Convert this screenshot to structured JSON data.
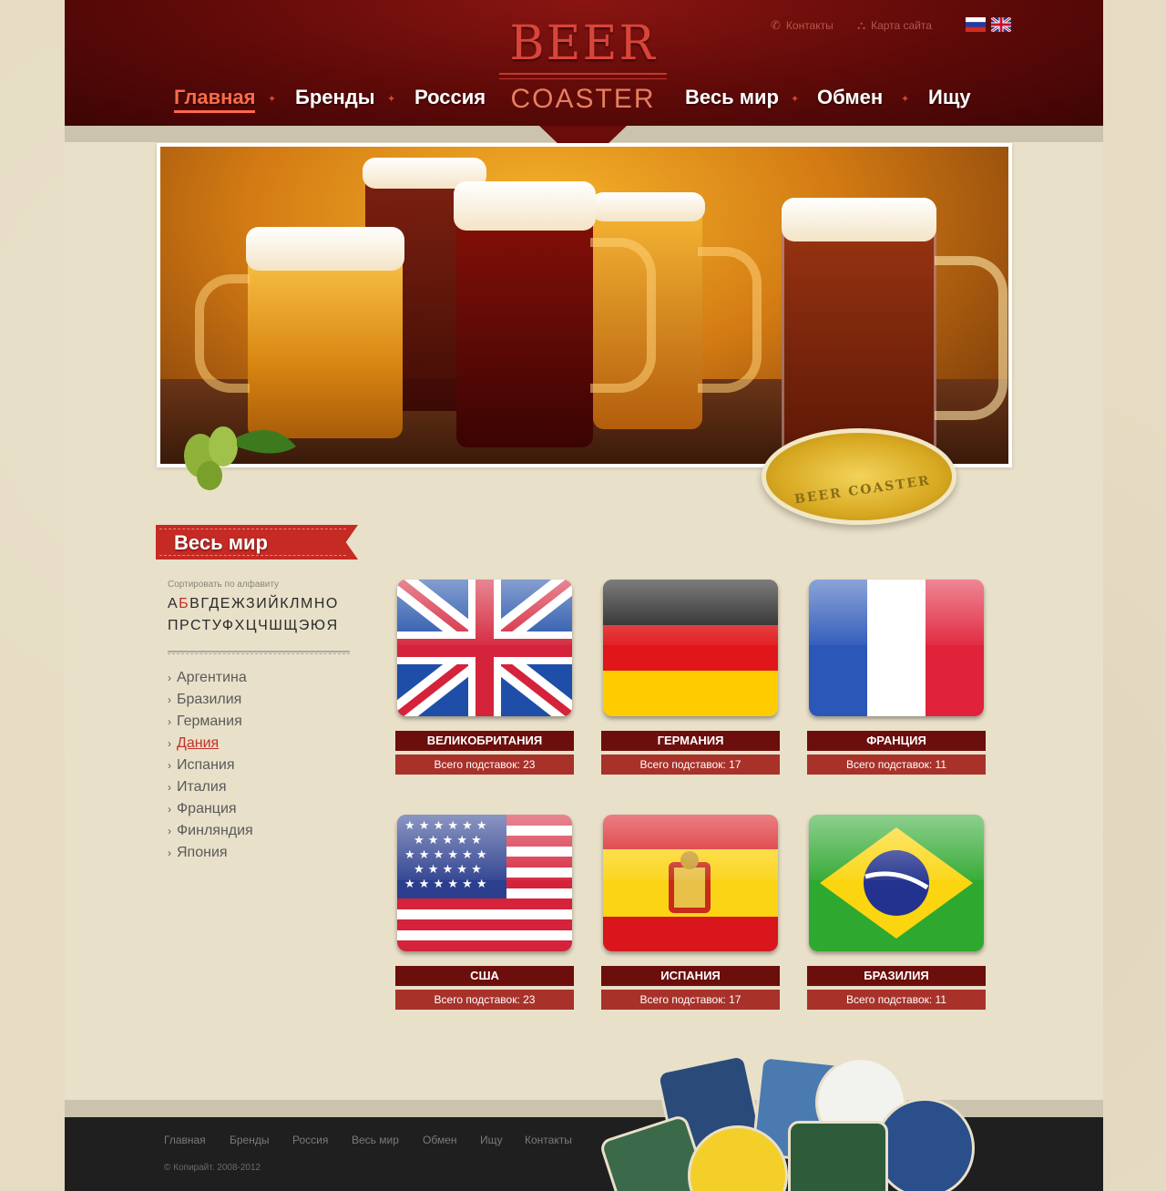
{
  "header": {
    "logo_top": "BEER",
    "logo_bottom": "COASTER",
    "nav": [
      "Главная",
      "Бренды",
      "Россия",
      "Весь мир",
      "Обмен",
      "Ищу"
    ],
    "active_nav": "Главная",
    "top_links": {
      "contacts": "Контакты",
      "sitemap": "Карта сайта"
    },
    "languages": [
      "ru",
      "en"
    ]
  },
  "hero": {
    "badge_text": "BEER COASTER"
  },
  "section": {
    "title": "Весь мир"
  },
  "sidebar": {
    "sort_label": "Сортировать по алфавиту",
    "alphabet_row1": {
      "a": "А",
      "hl": "Б",
      "rest": "ВГДЕЖЗИЙКЛМНО"
    },
    "alphabet_row2": "ПРСТУФХЦЧШЩЭЮЯ",
    "countries": [
      {
        "label": "Аргентина",
        "active": false
      },
      {
        "label": "Бразилия",
        "active": false
      },
      {
        "label": "Германия",
        "active": false
      },
      {
        "label": "Дания",
        "active": true
      },
      {
        "label": "Испания",
        "active": false
      },
      {
        "label": "Италия",
        "active": false
      },
      {
        "label": "Франция",
        "active": false
      },
      {
        "label": "Финляндия",
        "active": false
      },
      {
        "label": "Япония",
        "active": false
      }
    ]
  },
  "flags": [
    {
      "name": "ВЕЛИКОБРИТАНИЯ",
      "count": "Всего подставок: 23",
      "flag": "uk-flag"
    },
    {
      "name": "ГЕРМАНИЯ",
      "count": "Всего подставок: 17",
      "flag": "germany-flag"
    },
    {
      "name": "ФРАНЦИЯ",
      "count": "Всего подставок: 11",
      "flag": "france-flag"
    },
    {
      "name": "США",
      "count": "Всего подставок: 23",
      "flag": "usa-flag"
    },
    {
      "name": "ИСПАНИЯ",
      "count": "Всего подставок: 17",
      "flag": "spain-flag"
    },
    {
      "name": "БРАЗИЛИЯ",
      "count": "Всего подставок: 11",
      "flag": "brazil-flag"
    }
  ],
  "footer": {
    "links": [
      "Главная",
      "Бренды",
      "Россия",
      "Весь мир",
      "Обмен",
      "Ищу",
      "Контакты"
    ],
    "copyright": "© Копирайт. 2008-2012"
  },
  "colors": {
    "brand_red": "#c52a24",
    "header_dark": "#5e0a08",
    "active_link": "#c0322a",
    "background": "#e6dcc3"
  }
}
